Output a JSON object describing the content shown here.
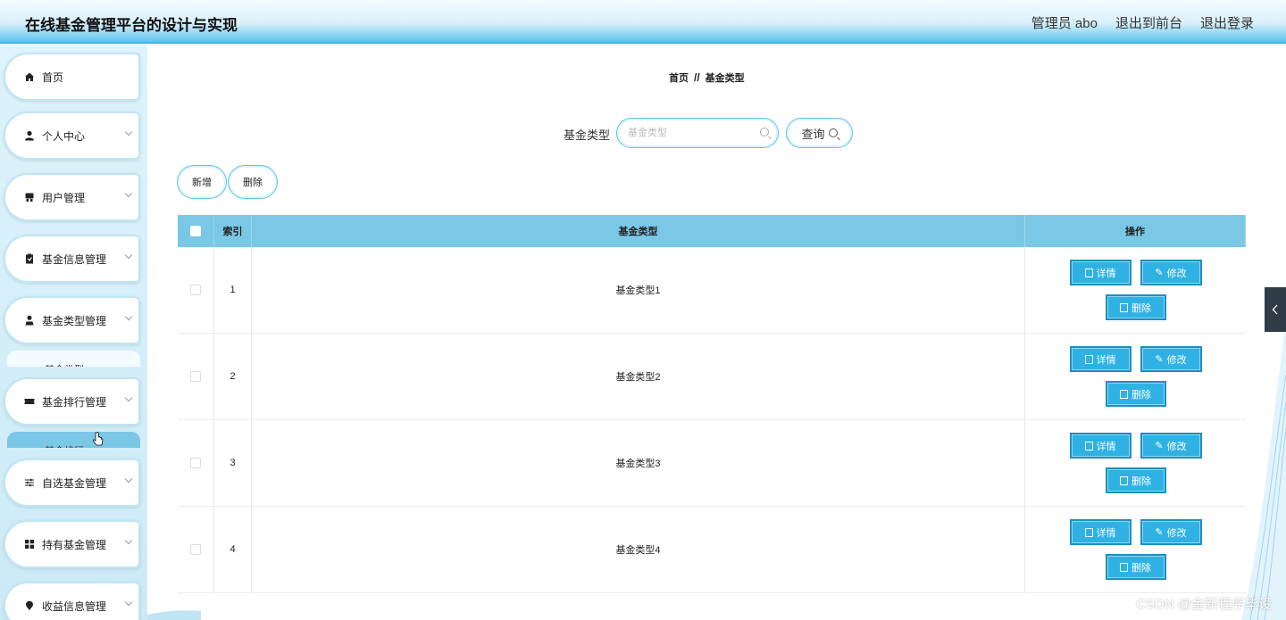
{
  "app": {
    "title": "在线基金管理平台的设计与实现"
  },
  "header": {
    "user": "管理员 abo",
    "to_front": "退出到前台",
    "logout": "退出登录"
  },
  "sidebar": {
    "items": [
      {
        "label": "首页",
        "icon": "home-icon",
        "has_children": false
      },
      {
        "label": "个人中心",
        "icon": "user-icon",
        "has_children": true
      },
      {
        "label": "用户管理",
        "icon": "users-icon",
        "has_children": true
      },
      {
        "label": "基金信息管理",
        "icon": "clipboard-icon",
        "has_children": true
      },
      {
        "label": "基金类型管理",
        "icon": "person-icon",
        "has_children": true
      },
      {
        "label": "基金排行管理",
        "icon": "ticket-icon",
        "has_children": true
      },
      {
        "label": "自选基金管理",
        "icon": "sliders-icon",
        "has_children": true
      },
      {
        "label": "持有基金管理",
        "icon": "grid-icon",
        "has_children": true
      },
      {
        "label": "收益信息管理",
        "icon": "pin-icon",
        "has_children": true
      }
    ],
    "sub_type": "基金类型",
    "sub_rank": "基金排行"
  },
  "breadcrumb": {
    "home": "首页",
    "separator": "//",
    "current": "基金类型"
  },
  "search": {
    "label": "基金类型",
    "placeholder": "基金类型",
    "button": "查询"
  },
  "actions": {
    "add": "新增",
    "delete": "删除"
  },
  "table": {
    "headers": {
      "index": "索引",
      "type": "基金类型",
      "ops": "操作"
    },
    "rows": [
      {
        "index": "1",
        "type": "基金类型1"
      },
      {
        "index": "2",
        "type": "基金类型2"
      },
      {
        "index": "3",
        "type": "基金类型3"
      },
      {
        "index": "4",
        "type": "基金类型4"
      }
    ],
    "op_labels": {
      "detail": "详情",
      "edit": "修改",
      "delete": "删除"
    }
  },
  "watermark": "CSDN @金新程序毕设",
  "colors": {
    "accent": "#2fb2e3",
    "header_th": "#7ac7e6",
    "sidebar_bg": "#d6eff9"
  }
}
